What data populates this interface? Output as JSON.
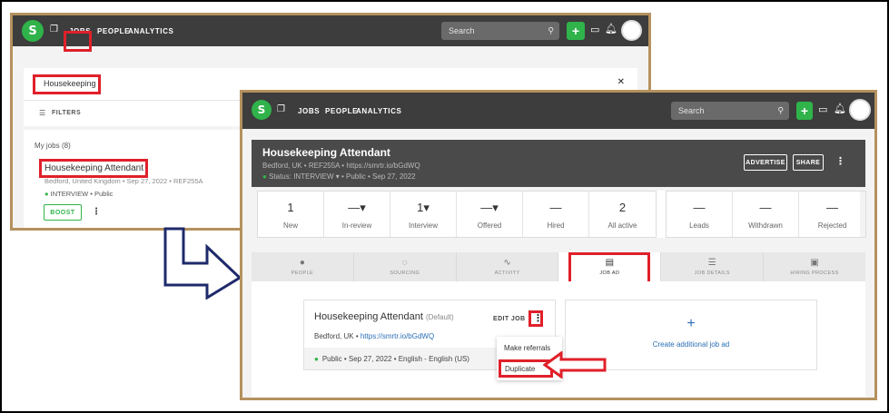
{
  "shot1": {
    "logo_letter": "S",
    "nav": {
      "jobs": "JOBS",
      "people": "PEOPLE",
      "analytics": "ANALYTICS"
    },
    "search_placeholder": "Search",
    "icons": [
      "bookmark-icon",
      "search-icon",
      "plus-icon",
      "inbox-icon",
      "bell-icon",
      "close-icon",
      "filter-icon",
      "kebab-menu-icon"
    ],
    "search_value": "Housekeeping",
    "close_glyph": "✕",
    "filters_label": "FILTERS",
    "my_jobs_label": "My jobs",
    "my_jobs_count": "(8)",
    "job": {
      "title": "Housekeeping Attendant",
      "meta": "Bedford, United Kingdom  •  Sep 27, 2022  •  REF255A",
      "status": "INTERVIEW",
      "visibility": "Public",
      "boost_label": "BOOST"
    }
  },
  "shot2": {
    "logo_letter": "S",
    "nav": {
      "jobs": "JOBS",
      "people": "PEOPLE",
      "analytics": "ANALYTICS"
    },
    "search_placeholder": "Search",
    "job_title": "Housekeeping Attendant",
    "job_meta": "Bedford, UK  •  REF255A  •  https://smrtr.io/bGdWQ",
    "status_line": "Status: INTERVIEW ▾  •  Public  •  Sep 27, 2022",
    "advertise_label": "ADVERTISE",
    "share_label": "SHARE",
    "stats_pipeline": [
      {
        "num": "1",
        "label": "New"
      },
      {
        "num": "—▾",
        "label": "In-review"
      },
      {
        "num": "1▾",
        "label": "Interview"
      },
      {
        "num": "—▾",
        "label": "Offered"
      },
      {
        "num": "—",
        "label": "Hired"
      },
      {
        "num": "2",
        "label": "All active"
      }
    ],
    "stats_other": [
      {
        "num": "—",
        "label": "Leads"
      },
      {
        "num": "—",
        "label": "Withdrawn"
      },
      {
        "num": "—",
        "label": "Rejected"
      }
    ],
    "tabs": [
      {
        "label": "PEOPLE",
        "icon": "person-icon",
        "glyph": "●"
      },
      {
        "label": "SOURCING",
        "icon": "sourcing-icon",
        "glyph": "◌"
      },
      {
        "label": "ACTIVITY",
        "icon": "activity-icon",
        "glyph": "∿"
      },
      {
        "label": "JOB AD",
        "icon": "document-icon",
        "glyph": "▤"
      },
      {
        "label": "JOB DETAILS",
        "icon": "sliders-icon",
        "glyph": "☰"
      },
      {
        "label": "HIRING PROCESS",
        "icon": "id-card-icon",
        "glyph": "▣"
      }
    ],
    "active_tab": "JOB AD",
    "ad": {
      "title": "Housekeeping Attendant",
      "default_tag": "(Default)",
      "location": "Bedford, UK",
      "link": "https://smrtr.io/bGdWQ",
      "footer": "Public  •  Sep 27, 2022  •  English - English (US)",
      "edit_label": "EDIT JOB"
    },
    "menu": {
      "make_referrals": "Make referrals",
      "duplicate": "Duplicate"
    },
    "create_ad_label": "Create additional job ad"
  },
  "colors": {
    "frame_border": "#b5915e",
    "highlight_red": "#e0202a",
    "brand_green": "#2fb34a",
    "topbar": "#3d3d3d",
    "arrow_navy": "#1f2a6b",
    "link_blue": "#2a6fb5"
  }
}
